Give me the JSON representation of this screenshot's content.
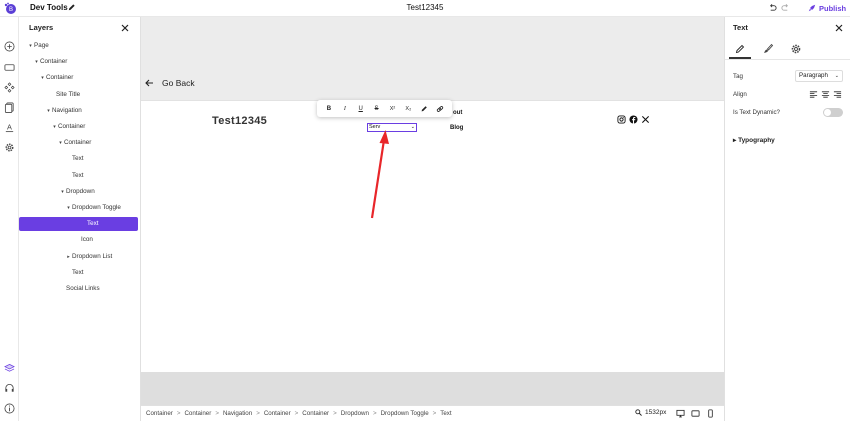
{
  "topbar": {
    "app_title": "Dev Tools",
    "document_title": "Test12345",
    "publish_label": "Publish",
    "brand_color": "#6b3fe0"
  },
  "rail_icons": [
    "add-icon",
    "layout-icon",
    "components-icon",
    "pages-icon",
    "typography-icon",
    "settings-icon",
    "layers-icon",
    "support-icon",
    "info-icon"
  ],
  "layers": {
    "title": "Layers",
    "items": [
      {
        "label": "Page",
        "caret": "▾"
      },
      {
        "label": "Container",
        "caret": "▾"
      },
      {
        "label": "Container",
        "caret": "▾"
      },
      {
        "label": "Site Title",
        "caret": ""
      },
      {
        "label": "Navigation",
        "caret": "▾"
      },
      {
        "label": "Container",
        "caret": "▾"
      },
      {
        "label": "Container",
        "caret": "▾"
      },
      {
        "label": "Text",
        "caret": ""
      },
      {
        "label": "Text",
        "caret": ""
      },
      {
        "label": "Dropdown",
        "caret": "▾"
      },
      {
        "label": "Dropdown Toggle",
        "caret": "▾"
      },
      {
        "label": "Text",
        "caret": "",
        "selected": true
      },
      {
        "label": "Icon",
        "caret": ""
      },
      {
        "label": "Dropdown List",
        "caret": "▸"
      },
      {
        "label": "Text",
        "caret": ""
      },
      {
        "label": "Social Links",
        "caret": ""
      }
    ]
  },
  "canvas": {
    "go_back_label": "Go Back",
    "site_title": "Test12345",
    "nav_about": "out",
    "nav_blog": "Blog",
    "dropdown_value": "Serv",
    "toolbar_buttons": [
      "B",
      "I",
      "U",
      "S",
      "X²",
      "X₂",
      "pen-icon",
      "link-icon"
    ],
    "social_icons": [
      "instagram-icon",
      "facebook-icon",
      "x-icon"
    ],
    "annotation_color": "#e8262a"
  },
  "breadcrumb": {
    "items": [
      "Container",
      "Container",
      "Navigation",
      "Container",
      "Container",
      "Dropdown",
      "Dropdown Toggle",
      "Text"
    ],
    "zoom": "1532px"
  },
  "properties": {
    "title": "Text",
    "tag_label": "Tag",
    "tag_value": "Paragraph",
    "align_label": "Align",
    "dynamic_label": "Is Text Dynamic?",
    "dynamic_enabled": false,
    "typography_label": "Typography"
  }
}
